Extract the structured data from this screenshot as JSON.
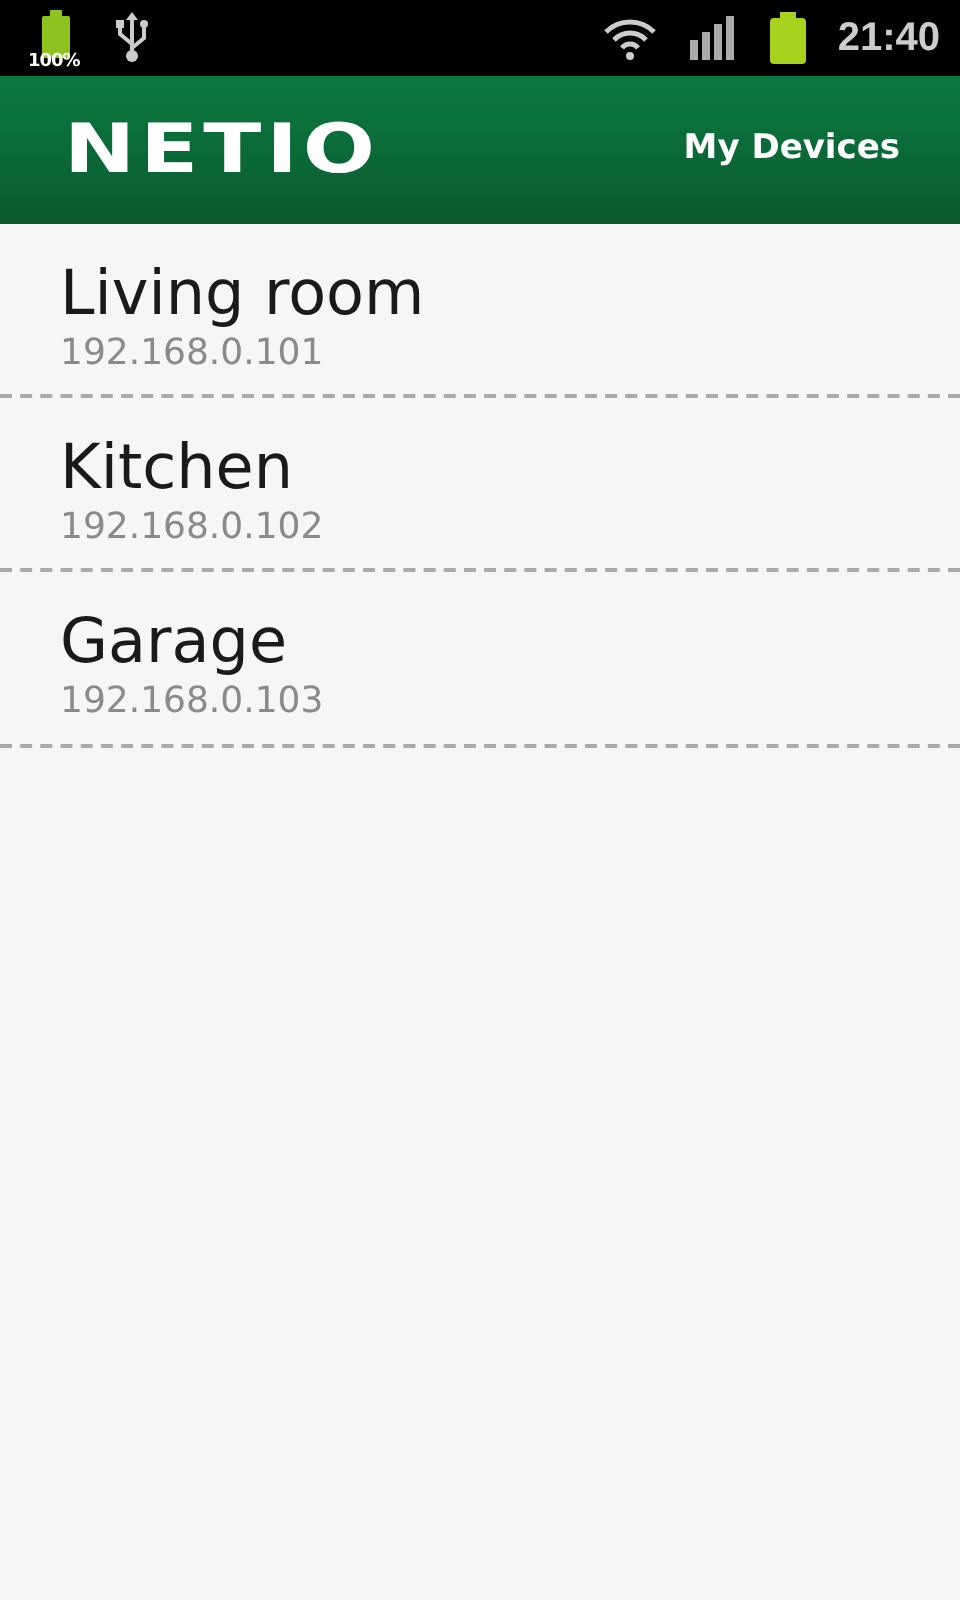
{
  "status_bar": {
    "battery_percent": "100%",
    "time": "21:40"
  },
  "app_bar": {
    "logo": "NETIO",
    "title": "My Devices"
  },
  "devices": [
    {
      "name": "Living room",
      "address": "192.168.0.101"
    },
    {
      "name": "Kitchen",
      "address": "192.168.0.102"
    },
    {
      "name": "Garage",
      "address": "192.168.0.103"
    }
  ]
}
